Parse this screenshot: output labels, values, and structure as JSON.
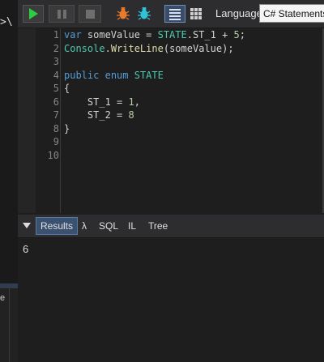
{
  "left_panel": {
    "text_top": ">\\",
    "text_bottom": "e"
  },
  "toolbar": {
    "run_icon": "play-icon",
    "pause_icon": "pause-icon",
    "stop_icon": "stop-icon",
    "bug_icons": [
      "bug-orange-icon",
      "bug-teal-icon"
    ],
    "view_icons": [
      "rich-text-results-icon",
      "data-grid-results-icon"
    ],
    "language_label": "Language",
    "language_value": "C# Statements"
  },
  "editor": {
    "line_numbers": [
      "1",
      "2",
      "3",
      "4",
      "5",
      "6",
      "7",
      "8",
      "9",
      "10"
    ],
    "lines": [
      [
        {
          "t": "var",
          "c": "kw"
        },
        {
          "t": " someValue = ",
          "c": "id"
        },
        {
          "t": "STATE",
          "c": "type"
        },
        {
          "t": ".ST_1 + ",
          "c": "id"
        },
        {
          "t": "5",
          "c": "num"
        },
        {
          "t": ";",
          "c": "id"
        }
      ],
      [
        {
          "t": "Console",
          "c": "type"
        },
        {
          "t": ".",
          "c": "id"
        },
        {
          "t": "WriteLine",
          "c": "meth"
        },
        {
          "t": "(someValue);",
          "c": "id"
        }
      ],
      [],
      [
        {
          "t": "public",
          "c": "kw"
        },
        {
          "t": " ",
          "c": "id"
        },
        {
          "t": "enum",
          "c": "kw"
        },
        {
          "t": " ",
          "c": "id"
        },
        {
          "t": "STATE",
          "c": "type"
        }
      ],
      [
        {
          "t": "{",
          "c": "id"
        }
      ],
      [
        {
          "t": "    ST_1 = ",
          "c": "id"
        },
        {
          "t": "1",
          "c": "num"
        },
        {
          "t": ",",
          "c": "id"
        }
      ],
      [
        {
          "t": "    ST_2 = ",
          "c": "id"
        },
        {
          "t": "8",
          "c": "num"
        }
      ],
      [
        {
          "t": "}",
          "c": "id"
        }
      ],
      [],
      []
    ]
  },
  "results_tabs": {
    "collapse_icon": "chevron-down-icon",
    "results": "Results",
    "lambda": "λ",
    "sql": "SQL",
    "il": "IL",
    "tree": "Tree"
  },
  "output": {
    "value": "6"
  },
  "colors": {
    "accent": "#3b5170",
    "keyword": "#569cd6",
    "type": "#4ec9b0",
    "number": "#b5cea8",
    "run": "#2ecc40"
  }
}
